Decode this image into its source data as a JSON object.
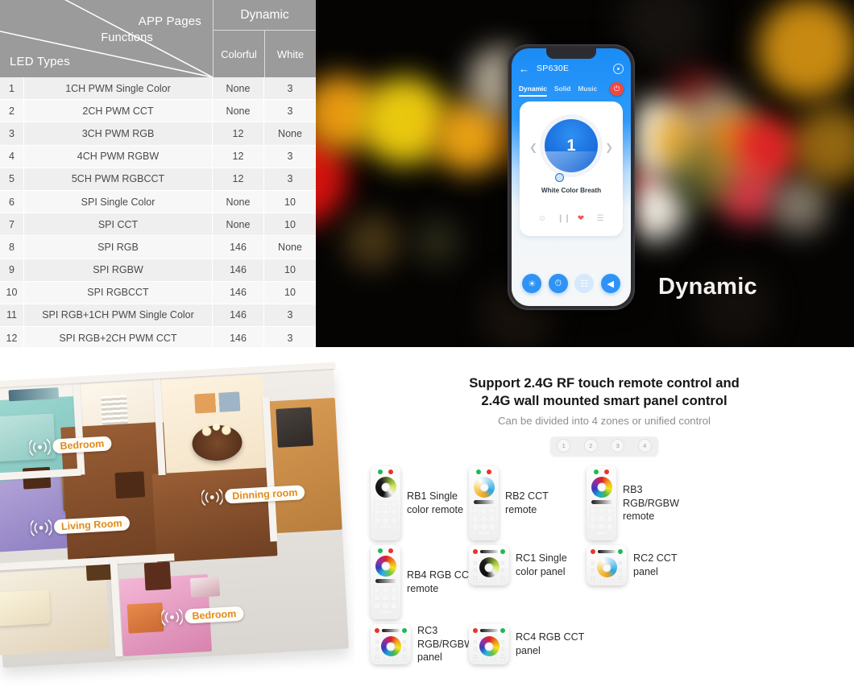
{
  "table": {
    "diag_labels": {
      "app_pages": "APP Pages",
      "functions": "Functions",
      "led_types": "LED Types"
    },
    "group_header": "Dynamic",
    "sub_headers": [
      "Colorful",
      "White"
    ],
    "rows": [
      {
        "idx": "1",
        "type": "1CH PWM Single Color",
        "colorful": "None",
        "white": "3"
      },
      {
        "idx": "2",
        "type": "2CH PWM CCT",
        "colorful": "None",
        "white": "3"
      },
      {
        "idx": "3",
        "type": "3CH PWM RGB",
        "colorful": "12",
        "white": "None"
      },
      {
        "idx": "4",
        "type": "4CH PWM RGBW",
        "colorful": "12",
        "white": "3"
      },
      {
        "idx": "5",
        "type": "5CH PWM RGBCCT",
        "colorful": "12",
        "white": "3"
      },
      {
        "idx": "6",
        "type": "SPI Single Color",
        "colorful": "None",
        "white": "10"
      },
      {
        "idx": "7",
        "type": "SPI CCT",
        "colorful": "None",
        "white": "10"
      },
      {
        "idx": "8",
        "type": "SPI RGB",
        "colorful": "146",
        "white": "None"
      },
      {
        "idx": "9",
        "type": "SPI RGBW",
        "colorful": "146",
        "white": "10"
      },
      {
        "idx": "10",
        "type": "SPI RGBCCT",
        "colorful": "146",
        "white": "10"
      },
      {
        "idx": "11",
        "type": "SPI RGB+1CH PWM Single Color",
        "colorful": "146",
        "white": "3"
      },
      {
        "idx": "12",
        "type": "SPI RGB+2CH PWM CCT",
        "colorful": "146",
        "white": "3"
      }
    ]
  },
  "hero": {
    "caption": "Dynamic",
    "phone": {
      "back_icon": "back-arrow-icon",
      "title": "SP630E",
      "gear_icon": "gear-icon",
      "tabs": [
        "Dynamic",
        "Solid",
        "Music"
      ],
      "active_tab": "Dynamic",
      "power_icon": "power-icon",
      "scene_number": "1",
      "scene_name": "White Color Breath",
      "prev_icon": "chevron-left-icon",
      "next_icon": "chevron-right-icon",
      "card_icons": [
        "smiley-icon",
        "pause-icon",
        "heart-icon",
        "list-icon"
      ],
      "bottom_icons": [
        "brightness-icon",
        "speed-icon",
        "segment-icon",
        "volume-icon"
      ]
    }
  },
  "floorplan": {
    "labels": [
      {
        "name": "Bedroom"
      },
      {
        "name": "Living Room"
      },
      {
        "name": "Dinning room"
      },
      {
        "name": "Bedroom"
      }
    ],
    "signal_icon": "wifi-signal-icon"
  },
  "remotes": {
    "title_line1": "Support 2.4G RF touch remote control and",
    "title_line2": "2.4G wall mounted smart panel control",
    "subtitle": "Can be divided into 4 zones or unified control",
    "zones": [
      "1",
      "2",
      "3",
      "4"
    ],
    "items": [
      {
        "id": "RB1",
        "label": "RB1 Single\ncolor remote",
        "kind": "remote",
        "wheel": "mono"
      },
      {
        "id": "RB2",
        "label": "RB2 CCT\nremote",
        "kind": "remote",
        "wheel": "cct"
      },
      {
        "id": "RB3",
        "label": "RB3\nRGB/RGBW\nremote",
        "kind": "remote",
        "wheel": "rgb"
      },
      {
        "id": "RB4",
        "label": "RB4 RGB CCT\nremote",
        "kind": "remote",
        "wheel": "rgbcct"
      },
      {
        "id": "RC1",
        "label": "RC1 Single\ncolor panel",
        "kind": "panel",
        "wheel": "mono"
      },
      {
        "id": "RC2",
        "label": "RC2 CCT\npanel",
        "kind": "panel",
        "wheel": "cct"
      },
      {
        "id": "RC3",
        "label": "RC3\nRGB/RGBW\npanel",
        "kind": "panel",
        "wheel": "rgb"
      },
      {
        "id": "RC4",
        "label": "RC4 RGB CCT\npanel",
        "kind": "panel",
        "wheel": "rgbcct"
      }
    ]
  },
  "colors": {
    "header_gray": "#9b9b9b",
    "row_alt": "#efefef",
    "row_plain": "#f7f7f7",
    "accent_blue": "#2f93f5",
    "pill_text": "#e08b1e",
    "power_red": "#f4473f"
  }
}
